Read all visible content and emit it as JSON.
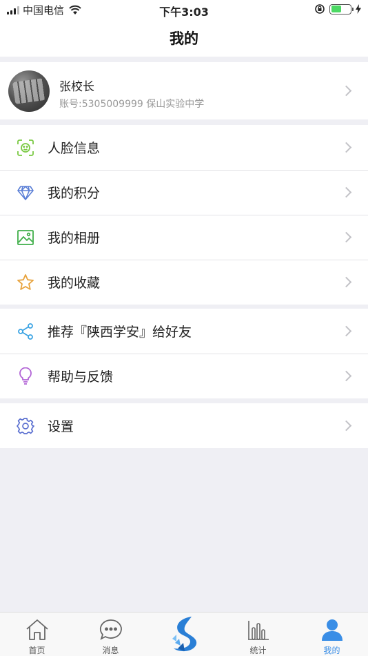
{
  "status_bar": {
    "carrier": "中国电信",
    "time": "下午3:03",
    "battery_level": 0.55
  },
  "header": {
    "title": "我的"
  },
  "profile": {
    "name": "张校长",
    "subtitle": "账号:5305009999 保山实验中学"
  },
  "menu_groups": [
    [
      {
        "label": "人脸信息",
        "icon": "face-id-icon",
        "color": "#7ac943"
      },
      {
        "label": "我的积分",
        "icon": "diamond-icon",
        "color": "#5b7fd6"
      },
      {
        "label": "我的相册",
        "icon": "image-icon",
        "color": "#3fae49"
      },
      {
        "label": "我的收藏",
        "icon": "star-icon",
        "color": "#e8a33d"
      }
    ],
    [
      {
        "label": "推荐『陕西学安』给好友",
        "icon": "share-icon",
        "color": "#3aa3e3"
      },
      {
        "label": "帮助与反馈",
        "icon": "lightbulb-icon",
        "color": "#b265d6"
      }
    ],
    [
      {
        "label": "设置",
        "icon": "gear-icon",
        "color": "#5a6fd0"
      }
    ]
  ],
  "tabbar": {
    "items": [
      {
        "label": "首页",
        "icon": "home-icon"
      },
      {
        "label": "消息",
        "icon": "chat-bubble-icon"
      },
      {
        "label": "",
        "icon": "app-logo-icon"
      },
      {
        "label": "统计",
        "icon": "bar-chart-icon"
      },
      {
        "label": "我的",
        "icon": "user-icon",
        "active": true
      }
    ],
    "active_color": "#3a8ee6"
  }
}
